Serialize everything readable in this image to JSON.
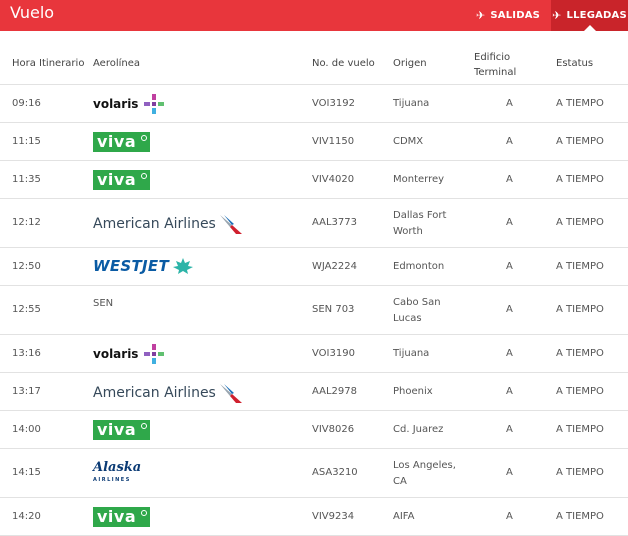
{
  "header": {
    "title": "Vuelo",
    "salidas": "SALIDAS",
    "llegadas": "LLEGADAS"
  },
  "columns": {
    "hora": "Hora Itinerario",
    "aerolinea": "Aerolínea",
    "vuelo": "No. de vuelo",
    "origen": "Origen",
    "edificio": "Edificio Terminal",
    "estatus": "Estatus"
  },
  "logos": {
    "volaris": "volaris",
    "viva": "viva",
    "american": "American Airlines",
    "westjet": "WESTJET",
    "alaska": "Alaska",
    "alaska_sub": "AIRLINES"
  },
  "flights": [
    {
      "hora": "09:16",
      "logo": "volaris",
      "aerolinea": "",
      "vuelo": "VOI3192",
      "origen": "Tijuana",
      "terminal": "A",
      "estatus": "A TIEMPO"
    },
    {
      "hora": "11:15",
      "logo": "viva",
      "aerolinea": "",
      "vuelo": "VIV1150",
      "origen": "CDMX",
      "terminal": "A",
      "estatus": "A TIEMPO"
    },
    {
      "hora": "11:35",
      "logo": "viva",
      "aerolinea": "",
      "vuelo": "VIV4020",
      "origen": "Monterrey",
      "terminal": "A",
      "estatus": "A TIEMPO"
    },
    {
      "hora": "12:12",
      "logo": "american",
      "aerolinea": "",
      "vuelo": "AAL3773",
      "origen": "Dallas Fort Worth",
      "terminal": "A",
      "estatus": "A TIEMPO"
    },
    {
      "hora": "12:50",
      "logo": "westjet",
      "aerolinea": "",
      "vuelo": "WJA2224",
      "origen": "Edmonton",
      "terminal": "A",
      "estatus": "A TIEMPO"
    },
    {
      "hora": "12:55",
      "logo": "text",
      "aerolinea": "SEN",
      "vuelo": "SEN 703",
      "origen": "Cabo San Lucas",
      "terminal": "A",
      "estatus": "A TIEMPO"
    },
    {
      "hora": "13:16",
      "logo": "volaris",
      "aerolinea": "",
      "vuelo": "VOI3190",
      "origen": "Tijuana",
      "terminal": "A",
      "estatus": "A TIEMPO"
    },
    {
      "hora": "13:17",
      "logo": "american",
      "aerolinea": "",
      "vuelo": "AAL2978",
      "origen": "Phoenix",
      "terminal": "A",
      "estatus": "A TIEMPO"
    },
    {
      "hora": "14:00",
      "logo": "viva",
      "aerolinea": "",
      "vuelo": "VIV8026",
      "origen": "Cd. Juarez",
      "terminal": "A",
      "estatus": "A TIEMPO"
    },
    {
      "hora": "14:15",
      "logo": "alaska",
      "aerolinea": "",
      "vuelo": "ASA3210",
      "origen": "Los Angeles, CA",
      "terminal": "A",
      "estatus": "A TIEMPO"
    },
    {
      "hora": "14:20",
      "logo": "viva",
      "aerolinea": "",
      "vuelo": "VIV9234",
      "origen": "AIFA",
      "terminal": "A",
      "estatus": "A TIEMPO"
    }
  ]
}
